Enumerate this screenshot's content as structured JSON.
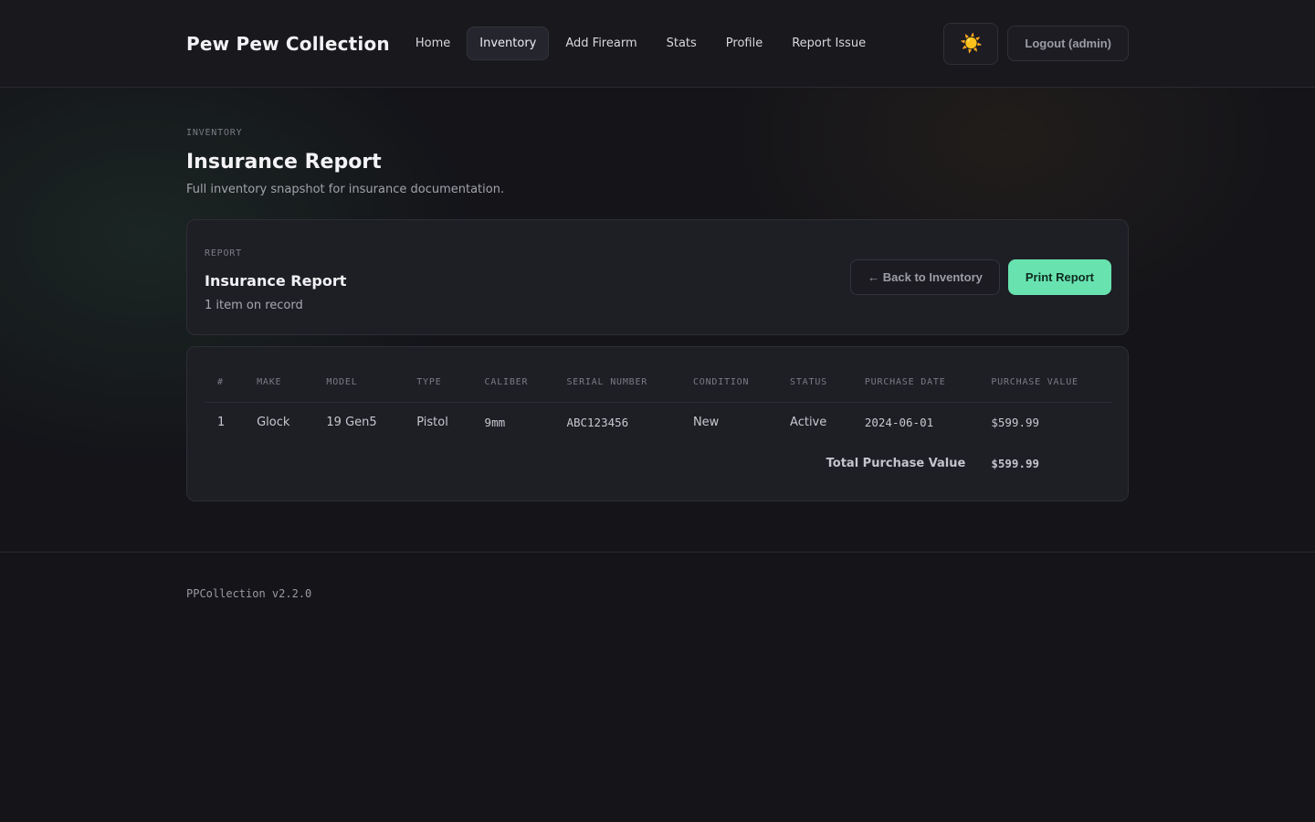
{
  "header": {
    "brand": "Pew Pew Collection",
    "nav": [
      {
        "label": "Home",
        "active": false
      },
      {
        "label": "Inventory",
        "active": true
      },
      {
        "label": "Add Firearm",
        "active": false
      },
      {
        "label": "Stats",
        "active": false
      },
      {
        "label": "Profile",
        "active": false
      },
      {
        "label": "Report Issue",
        "active": false
      }
    ],
    "theme_icon": "☀️",
    "logout_label": "Logout (admin)"
  },
  "page": {
    "eyebrow": "INVENTORY",
    "title": "Insurance Report",
    "subtitle": "Full inventory snapshot for insurance documentation."
  },
  "report": {
    "label": "REPORT",
    "title": "Insurance Report",
    "count": "1 item on record",
    "back_label": "← Back to Inventory",
    "print_label": "Print Report",
    "accent_color": "#68e3b0"
  },
  "table": {
    "columns": [
      "#",
      "MAKE",
      "MODEL",
      "TYPE",
      "CALIBER",
      "SERIAL NUMBER",
      "CONDITION",
      "STATUS",
      "PURCHASE DATE",
      "PURCHASE VALUE"
    ],
    "rows": [
      [
        "1",
        "Glock",
        "19 Gen5",
        "Pistol",
        "9mm",
        "ABC123456",
        "New",
        "Active",
        "2024-06-01",
        "$599.99"
      ]
    ],
    "total_label": "Total Purchase Value",
    "total_value": "$599.99"
  },
  "footer": {
    "version": "PPCollection v2.2.0"
  }
}
